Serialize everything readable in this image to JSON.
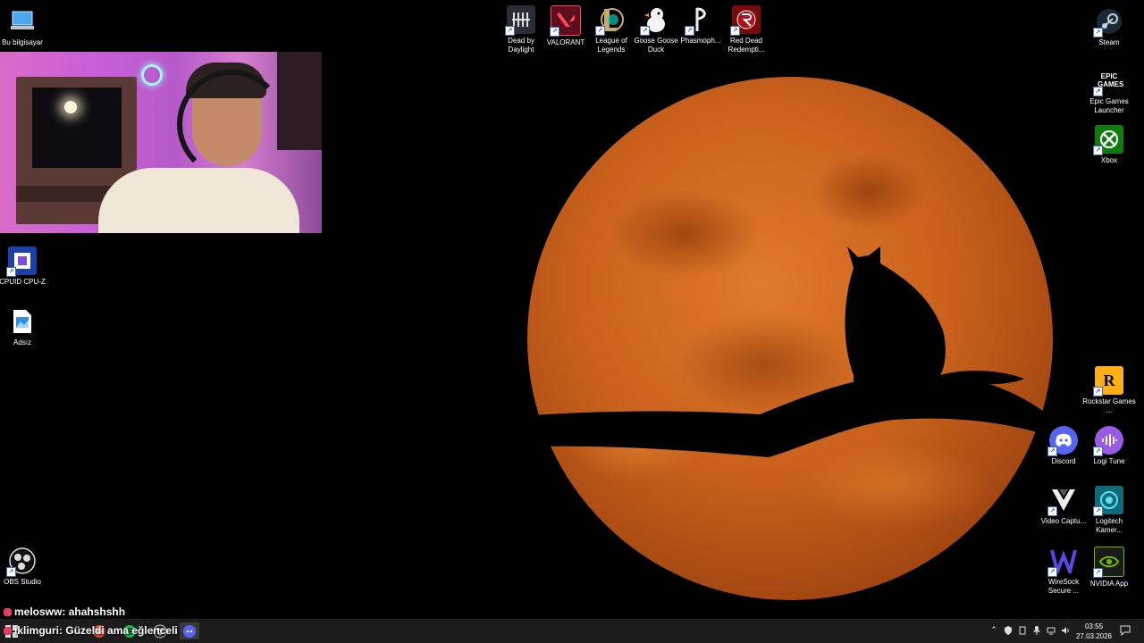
{
  "desktop": {
    "left_icons": [
      {
        "label": "Bu bilgisayar",
        "icon": "computer-icon"
      },
      {
        "label": "CPUID CPU-Z",
        "icon": "cpuz-icon"
      },
      {
        "label": "Adsız",
        "icon": "image-file-icon"
      },
      {
        "label": "OBS Studio",
        "icon": "obs-icon"
      }
    ],
    "top_icons": [
      {
        "label": "Dead by Daylight",
        "icon": "dead-by-daylight-icon"
      },
      {
        "label": "VALORANT",
        "icon": "valorant-icon"
      },
      {
        "label": "League of Legends",
        "icon": "league-of-legends-icon"
      },
      {
        "label": "Goose Goose Duck",
        "icon": "goose-goose-duck-icon"
      },
      {
        "label": "Phasmoph...",
        "icon": "phasmophobia-icon"
      },
      {
        "label": "Red Dead Redempti...",
        "icon": "red-dead-redemption-icon"
      }
    ],
    "right_icons": [
      {
        "label": "Steam",
        "icon": "steam-icon"
      },
      {
        "label": "Epic Games Launcher",
        "icon": "epic-games-icon",
        "logo_text": "EPIC GAMES"
      },
      {
        "label": "Xbox",
        "icon": "xbox-icon"
      },
      {
        "label": "Rockstar Games ...",
        "icon": "rockstar-icon",
        "logo_text": "R"
      },
      {
        "label": "Discord",
        "icon": "discord-icon"
      },
      {
        "label": "Logi Tune",
        "icon": "logi-tune-icon"
      },
      {
        "label": "Video Captu...",
        "icon": "video-capture-icon"
      },
      {
        "label": "Logitech Kamer...",
        "icon": "logitech-camera-icon"
      },
      {
        "label": "WireSock Secure ...",
        "icon": "wiresock-icon"
      },
      {
        "label": "NVIDIA App",
        "icon": "nvidia-icon"
      }
    ]
  },
  "chat": [
    {
      "user": "melosww",
      "message": "ahahshshh"
    },
    {
      "user": "iklimguri",
      "message": "Güzeldi ama eğlenceli"
    }
  ],
  "taskbar": {
    "clock_time": "03:55",
    "clock_date": "27.03.2026",
    "tray_icons": [
      "chevron-up-icon",
      "security-icon",
      "usb-icon",
      "microphone-icon",
      "network-icon",
      "volume-icon",
      "notification-icon"
    ]
  },
  "colors": {
    "moon": "#c8601c",
    "taskbar": "#1c1c1c",
    "chat_badge": "#e0405e"
  }
}
